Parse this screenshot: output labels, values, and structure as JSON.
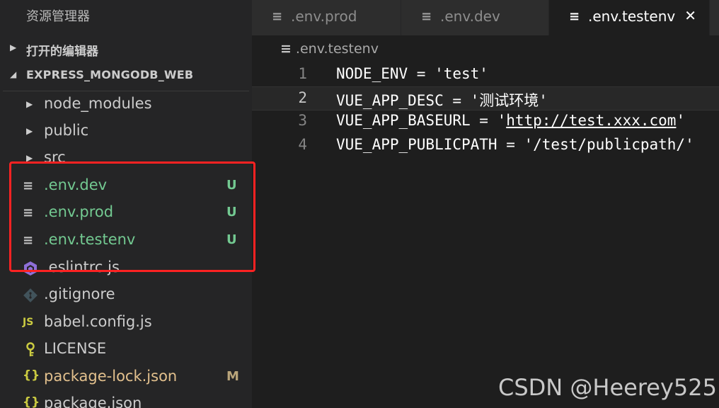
{
  "sidebar": {
    "title": "资源管理器",
    "open_editors": "打开的编辑器",
    "project": "EXPRESS_MONGODB_WEB",
    "items": [
      {
        "name": "node_modules",
        "type": "folder"
      },
      {
        "name": "public",
        "type": "folder"
      },
      {
        "name": "src",
        "type": "folder"
      },
      {
        "name": ".env.dev",
        "type": "file",
        "status": "U"
      },
      {
        "name": ".env.prod",
        "type": "file",
        "status": "U"
      },
      {
        "name": ".env.testenv",
        "type": "file",
        "status": "U"
      },
      {
        "name": ".eslintrc.js",
        "type": "file"
      },
      {
        "name": ".gitignore",
        "type": "file"
      },
      {
        "name": "babel.config.js",
        "type": "file",
        "icon_text": "JS"
      },
      {
        "name": "LICENSE",
        "type": "file"
      },
      {
        "name": "package-lock.json",
        "type": "file",
        "status": "M",
        "icon_text": "{}"
      },
      {
        "name": "package.json",
        "type": "file",
        "icon_text": "{}"
      }
    ]
  },
  "tabs": [
    {
      "label": ".env.prod",
      "active": false
    },
    {
      "label": ".env.dev",
      "active": false
    },
    {
      "label": ".env.testenv",
      "active": true
    }
  ],
  "breadcrumb": ".env.testenv",
  "editor": {
    "lines": [
      {
        "num": "1",
        "text": "NODE_ENV = 'test'"
      },
      {
        "num": "2",
        "text": "VUE_APP_DESC = '测试环境'"
      },
      {
        "num": "3",
        "prefix": "VUE_APP_BASEURL = '",
        "url": "http://test.xxx.com",
        "suffix": "'"
      },
      {
        "num": "4",
        "text": "VUE_APP_PUBLICPATH = '/test/publicpath/'"
      }
    ]
  },
  "icons": {
    "file": "≡",
    "chevron": "▶",
    "chevron_down": "◢",
    "close": "✕"
  },
  "watermark": "CSDN @Heerey525",
  "colors": {
    "untracked": "#73c991",
    "modified": "#e2c08d",
    "highlight": "#ff2222"
  }
}
